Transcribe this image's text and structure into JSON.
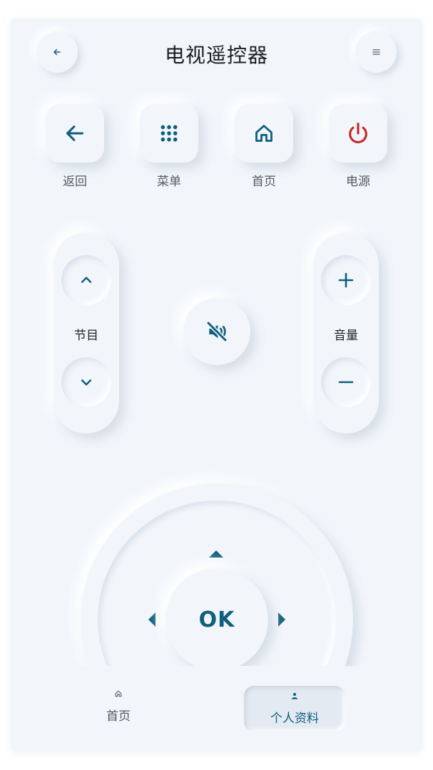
{
  "header": {
    "title": "电视遥控器",
    "back_icon": "arrow-left-icon",
    "menu_icon": "hamburger-menu-icon"
  },
  "quick_actions": [
    {
      "label": "返回",
      "icon": "arrow-left-icon"
    },
    {
      "label": "菜单",
      "icon": "grid-dots-icon"
    },
    {
      "label": "首页",
      "icon": "home-icon"
    },
    {
      "label": "电源",
      "icon": "power-icon"
    }
  ],
  "channel": {
    "label": "节目",
    "up_icon": "chevron-up-icon",
    "down_icon": "chevron-down-icon"
  },
  "volume": {
    "label": "音量",
    "up_icon": "plus-icon",
    "down_icon": "minus-icon"
  },
  "mute": {
    "icon": "mute-icon"
  },
  "dpad": {
    "ok_label": "OK"
  },
  "bottom_nav": {
    "items": [
      {
        "label": "首页",
        "icon": "home-icon",
        "active": false
      },
      {
        "label": "个人资料",
        "icon": "person-icon",
        "active": true
      }
    ]
  },
  "colors": {
    "background": "#f2f6fb",
    "accent": "#0f5f7d",
    "power": "#c62828"
  }
}
